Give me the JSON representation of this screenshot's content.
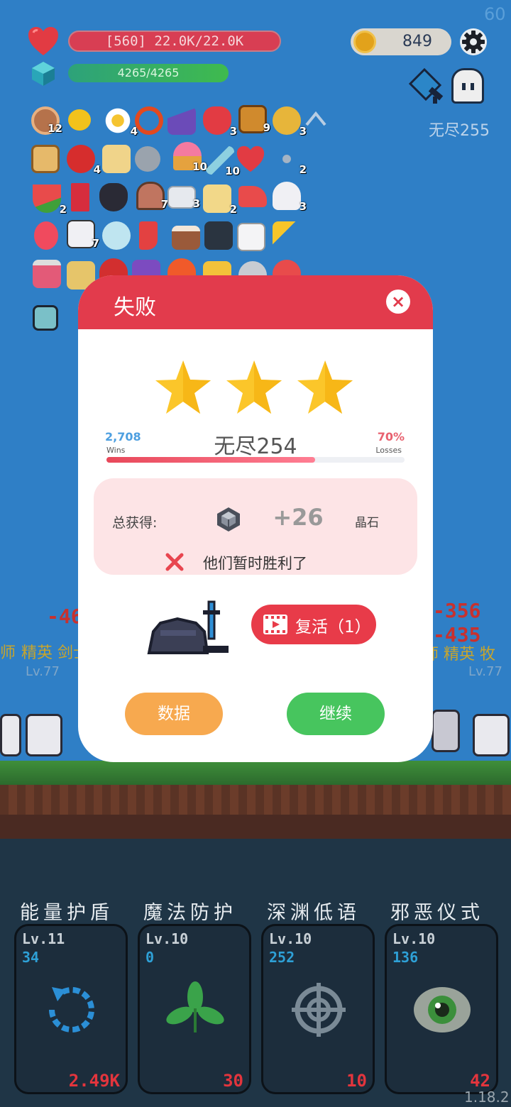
{
  "hud": {
    "fps": "60",
    "hp_text": "[560] 22.0K/22.0K",
    "mp_text": "4265/4265",
    "coins": "849",
    "wave_label": "无尽255"
  },
  "inventory": {
    "counts": [
      "12",
      "4",
      "3",
      "9",
      "3",
      "4",
      "10",
      "10",
      "2",
      "2",
      "7",
      "3",
      "2",
      "3",
      "7"
    ]
  },
  "battle": {
    "damage_left": "-46",
    "damage_right_1": "-356",
    "damage_right_2": "-435",
    "elite_left": "精英 剑士",
    "elite_left_prefix": "师",
    "elite_right": "师 精英 牧",
    "lv_left": "Lv.77",
    "lv_right": "Lv.77"
  },
  "skills": [
    {
      "title": "能量护盾",
      "level": "Lv.11",
      "count": "34",
      "value": "2.49K",
      "icon": "refresh-dashed-icon",
      "color": "#2b8fd6"
    },
    {
      "title": "魔法防护",
      "level": "Lv.10",
      "count": "0",
      "value": "30",
      "icon": "leaf-icon",
      "color": "#3aa34a"
    },
    {
      "title": "深渊低语",
      "level": "Lv.10",
      "count": "252",
      "value": "10",
      "icon": "crosshair-icon",
      "color": "#7a8a96"
    },
    {
      "title": "邪恶仪式",
      "level": "Lv.10",
      "count": "136",
      "value": "42",
      "icon": "eye-icon",
      "color": "#9aa39a"
    }
  ],
  "version": "1.18.2",
  "modal": {
    "title": "失败",
    "close_symbol": "×",
    "stars": 3,
    "wins_count": "2,708",
    "wins_label": "Wins",
    "stage_name": "无尽254",
    "loss_pct": "70%",
    "loss_label": "Losses",
    "ratio_fill": 0.7,
    "reward_label": "总获得:",
    "reward_amount": "+26",
    "reward_unit": "晶石",
    "defeat_message": "他们暂时胜利了",
    "revive_label": "复活（1）",
    "stats_button": "数据",
    "continue_button": "继续"
  },
  "colors": {
    "header_red": "#e23b4c",
    "star_yellow": "#fbc62a",
    "button_orange": "#f7a94f",
    "button_green": "#47c55e"
  }
}
